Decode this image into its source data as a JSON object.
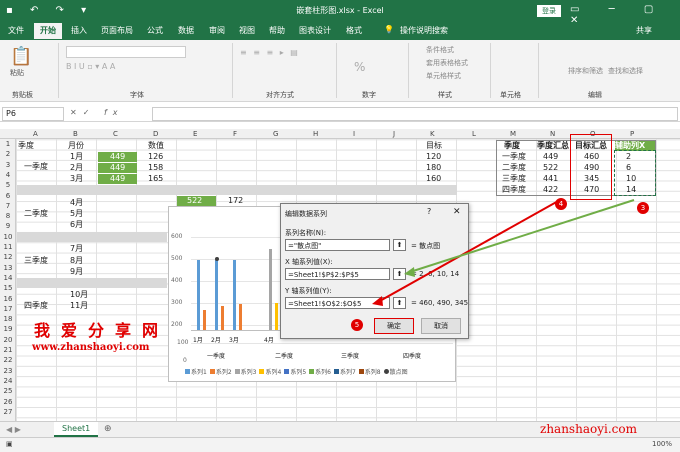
{
  "titlebar": {
    "title": "嵌套柱形图.xlsx - Excel",
    "login": "登录"
  },
  "tabs": [
    "文件",
    "开始",
    "插入",
    "页面布局",
    "公式",
    "数据",
    "审阅",
    "视图",
    "帮助",
    "图表设计",
    "格式"
  ],
  "search": "操作说明搜索",
  "share": "共享",
  "ribbon": {
    "paste": "粘贴",
    "clipboard": "剪贴板",
    "font": "字体",
    "align": "对齐方式",
    "number": "数字",
    "percent": "%",
    "styles": "样式",
    "cells": "单元格",
    "editing": "编辑",
    "cond_fmt": "条件格式",
    "table_fmt": "套用表格格式",
    "cell_style": "单元格样式",
    "sort": "排序和筛选",
    "find": "查找和选择"
  },
  "namebox": "P6",
  "fx": "fx",
  "columns": [
    "A",
    "B",
    "C",
    "D",
    "E",
    "F",
    "G",
    "H",
    "I",
    "J",
    "K",
    "L",
    "M",
    "N",
    "O",
    "P"
  ],
  "rows": [
    "1",
    "2",
    "3",
    "4",
    "5",
    "6",
    "7",
    "8",
    "9",
    "10",
    "11",
    "12",
    "13",
    "14",
    "15",
    "16",
    "17",
    "18",
    "19",
    "20",
    "21",
    "22",
    "23",
    "24",
    "25",
    "26",
    "27"
  ],
  "table": {
    "h_quarter": "季度",
    "h_month": "月份",
    "h_value": "数值",
    "h_target": "目标",
    "q1": "一季度",
    "q2": "二季度",
    "q3": "三季度",
    "q4": "四季度",
    "m1": "1月",
    "m2": "2月",
    "m3": "3月",
    "m4": "4月",
    "m5": "5月",
    "m6": "6月",
    "m7": "7月",
    "m8": "8月",
    "m9": "9月",
    "m10": "10月",
    "m11": "11月",
    "c2": "449",
    "c3": "449",
    "c4": "449",
    "d2": "126",
    "d3": "158",
    "d4": "165",
    "k2": "120",
    "k3": "180",
    "k4": "160",
    "e6": "522",
    "f6": "172"
  },
  "summary": {
    "h_q": "季度",
    "h_sum": "季度汇总",
    "h_target": "目标汇总",
    "h_aux": "辅助列X",
    "rows": [
      [
        "一季度",
        "449",
        "460",
        "2"
      ],
      [
        "二季度",
        "522",
        "490",
        "6"
      ],
      [
        "三季度",
        "441",
        "345",
        "10"
      ],
      [
        "四季度",
        "422",
        "470",
        "14"
      ]
    ]
  },
  "chart_data": {
    "type": "bar",
    "y_ticks": [
      "600",
      "500",
      "400",
      "300",
      "200",
      "100",
      "0"
    ],
    "ylim": [
      0,
      600
    ],
    "x_months": [
      "1月",
      "2月",
      "3月",
      "4月"
    ],
    "x_groups": [
      "一季度",
      "二季度",
      "三季度",
      "四季度"
    ],
    "legend": [
      "系列1",
      "系列2",
      "系列3",
      "系列4",
      "系列5",
      "系列6",
      "系列7",
      "系列8",
      "散点图"
    ],
    "legend_colors": [
      "#5b9bd5",
      "#ed7d31",
      "#a5a5a5",
      "#ffc000",
      "#4472c4",
      "#70ad47",
      "#255e91",
      "#9e480e",
      "#404040"
    ],
    "bars": [
      {
        "x": "1月",
        "series": 1,
        "value": 449
      },
      {
        "x": "1月",
        "series": 2,
        "value": 126
      },
      {
        "x": "2月",
        "series": 1,
        "value": 449
      },
      {
        "x": "2月",
        "series": 2,
        "value": 158
      },
      {
        "x": "3月",
        "series": 1,
        "value": 449
      },
      {
        "x": "3月",
        "series": 2,
        "value": 165
      },
      {
        "x": "4月",
        "series": 3,
        "value": 522
      },
      {
        "x": "4月",
        "series": 4,
        "value": 172
      }
    ],
    "scatter": {
      "name": "散点图",
      "value": 460
    }
  },
  "dialog": {
    "title": "编辑数据系列",
    "help": "?",
    "close": "✕",
    "name_label": "系列名称(N):",
    "name_value": "=\"散点图\"",
    "name_result": "= 散点图",
    "x_label": "X 轴系列值(X):",
    "x_value": "=Sheet1!$P$2:$P$5",
    "x_result": "= 2, 6, 10, 14",
    "y_label": "Y 轴系列值(Y):",
    "y_value": "=Sheet1!$O$2:$O$5",
    "y_result": "= 460, 490, 345",
    "ok": "确定",
    "cancel": "取消"
  },
  "sheet": "Sheet1",
  "zoom": "100%",
  "watermark": {
    "text": "我爱分享网",
    "url": "www.zhanshaoyi.com",
    "url2": "zhanshaoyi.com"
  },
  "badges": {
    "b3": "3",
    "b4": "4",
    "b5": "5"
  }
}
